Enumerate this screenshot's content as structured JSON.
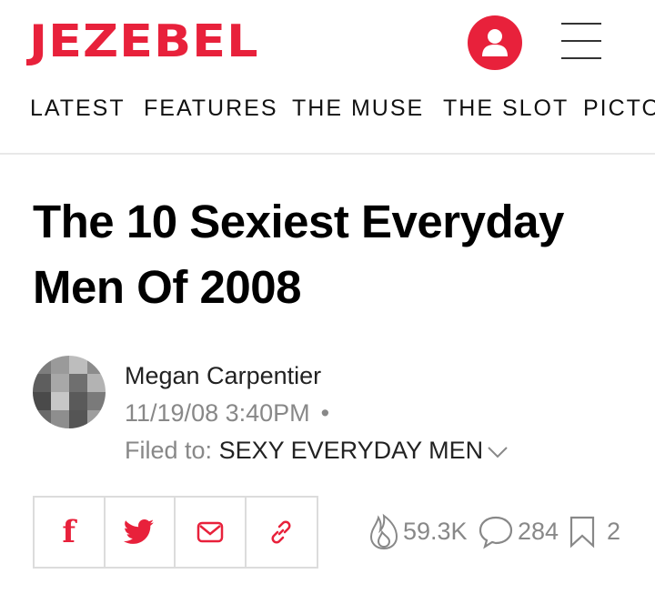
{
  "header": {
    "logo": "JEZEBEL",
    "nav": [
      "LATEST",
      "FEATURES",
      "THE MUSE",
      "THE SLOT",
      "PICTO"
    ]
  },
  "article": {
    "title": "The 10 Sexiest Everyday Men Of 2008",
    "author": "Megan Carpentier",
    "datetime": "11/19/08 3:40PM",
    "separator": "•",
    "filed_prefix": "Filed to:",
    "filed_tag": "SEXY EVERYDAY MEN"
  },
  "stats": {
    "views": "59.3K",
    "comments": "284",
    "saves": "2"
  },
  "colors": {
    "brand": "#e8213b",
    "muted": "#888888"
  },
  "icons": [
    "user-icon",
    "hamburger-icon",
    "chevron-down-icon",
    "facebook-icon",
    "twitter-icon",
    "email-icon",
    "link-icon",
    "flame-icon",
    "comment-icon",
    "bookmark-icon"
  ]
}
